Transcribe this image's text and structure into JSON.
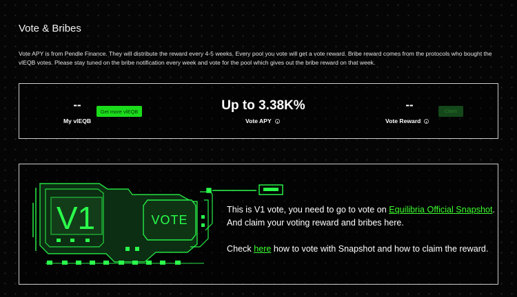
{
  "page": {
    "title": "Vote & Bribes",
    "description": "Vote APY is from Pendle Finance. They will distribute the reward every 4-5 weeks. Every pool you vote will get a vote reward. Bribe reward comes from the protocols who bought the vlEQB votes. Please stay tuned on the bribe notification every week and vote for the pool which gives out the bribe reward on that week."
  },
  "stats": {
    "my_vleqb_value": "--",
    "my_vleqb_label": "My vlEQB",
    "get_more_label": "Get more vlEQB",
    "vote_apy_value": "Up to 3.38K%",
    "vote_apy_label": "Vote APY",
    "vote_reward_value": "--",
    "vote_reward_label": "Vote Reward",
    "claim_label": "Claim"
  },
  "art": {
    "big_text": "V1",
    "small_text": "VOTE",
    "accent": "#2bff4c"
  },
  "info": {
    "p1_before": "This is V1 vote, you need to go to vote on ",
    "p1_link": "Equilibria Official Snapshot",
    "p1_after": ". And claim your voting reward and bribes here.",
    "p2_before": "Check ",
    "p2_link": "here",
    "p2_after": " how to vote with Snapshot and how to claim the reward."
  },
  "colors": {
    "accent_green": "#1bdc1b",
    "link_green": "#3cff2e",
    "background": "#050505",
    "border": "#cfcfcf"
  }
}
